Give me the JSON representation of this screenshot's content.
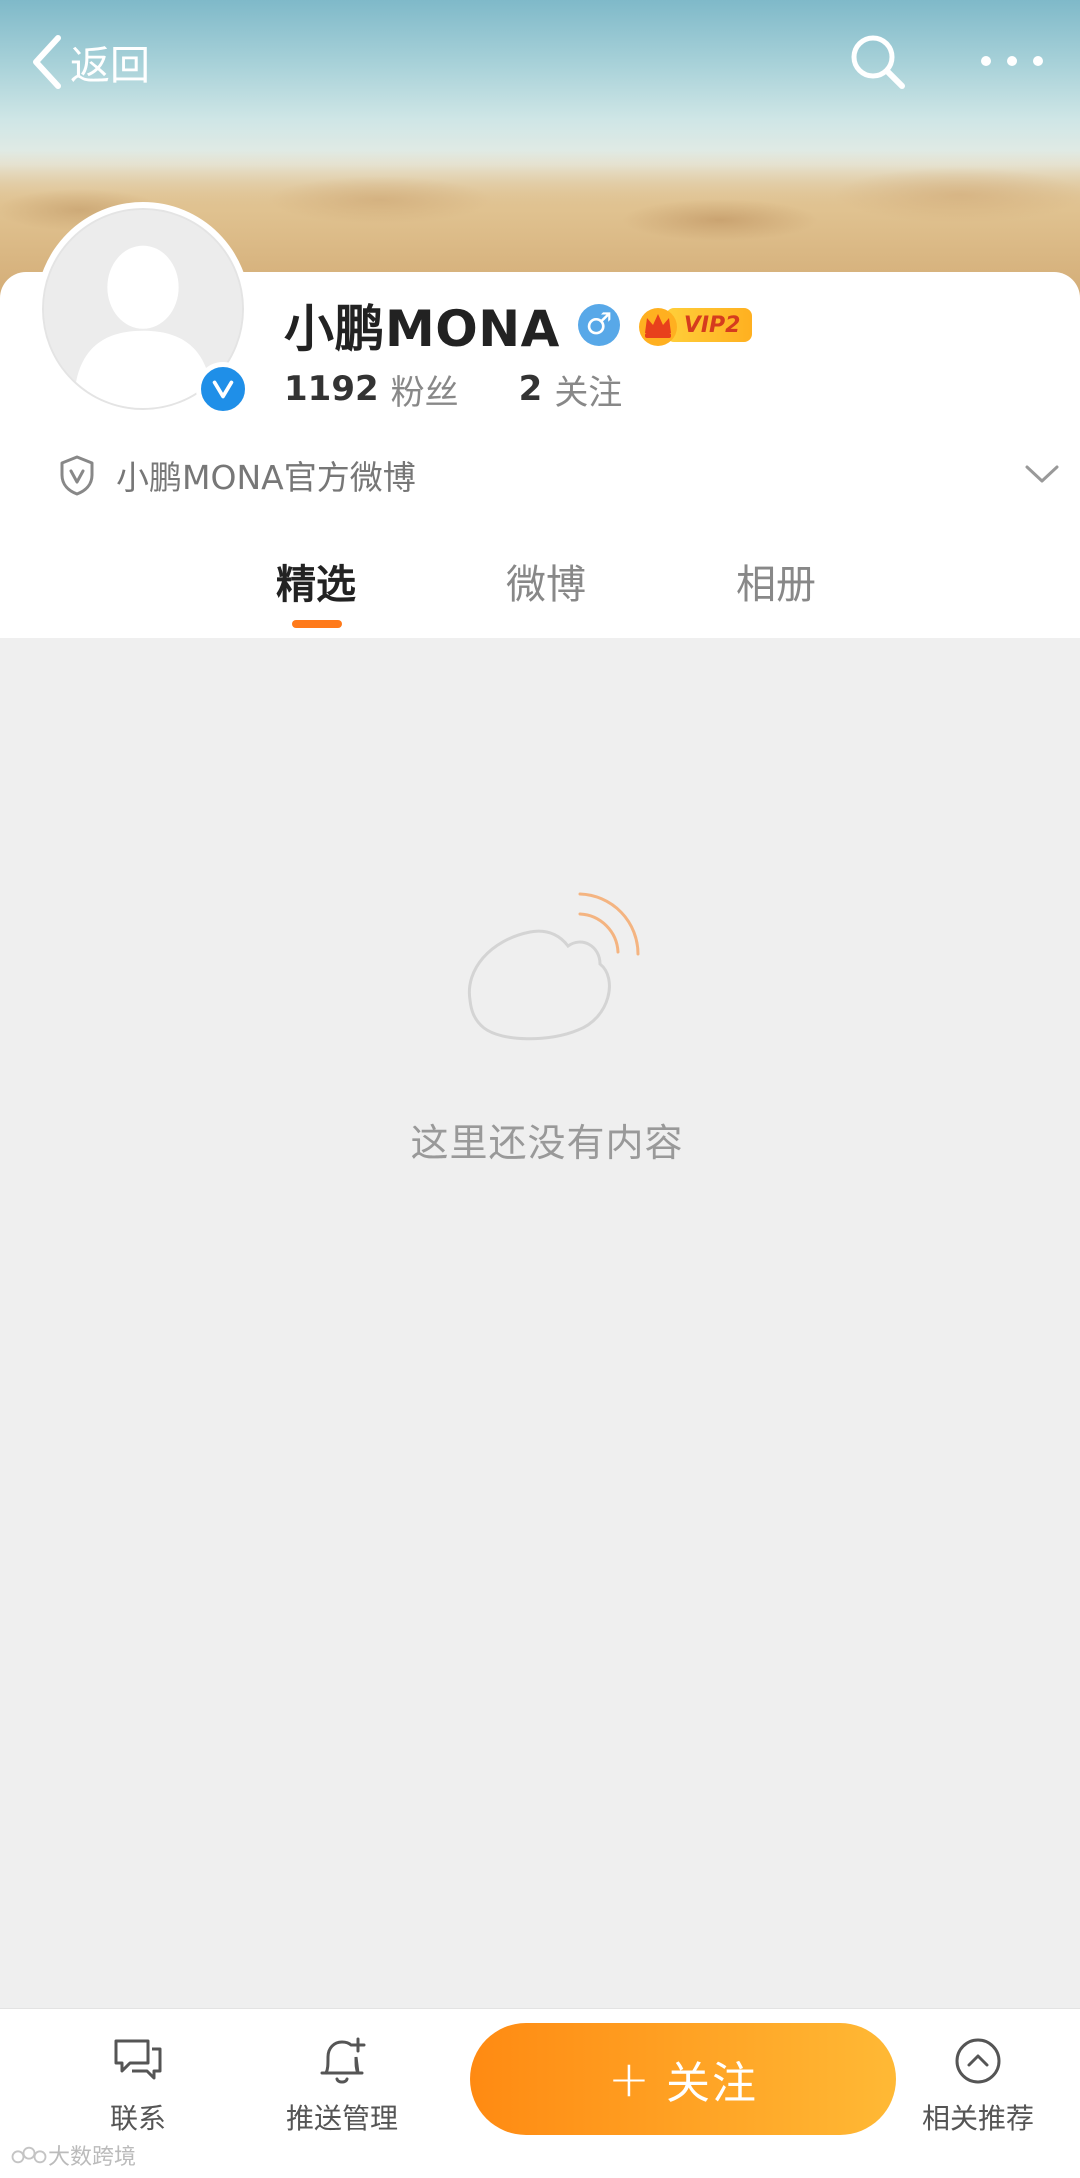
{
  "header": {
    "back_label": "返回",
    "search_icon": "search-icon",
    "more_icon": "more-icon"
  },
  "profile": {
    "name": "小鹏MONA",
    "gender_symbol": "♂",
    "vip_label": "VIP2",
    "fans_count": "1192",
    "fans_label": "粉丝",
    "following_count": "2",
    "following_label": "关注",
    "description": "小鹏MONA官方微博",
    "verified_mark": "V"
  },
  "tabs": [
    {
      "label": "精选",
      "active": true
    },
    {
      "label": "微博",
      "active": false
    },
    {
      "label": "相册",
      "active": false
    }
  ],
  "content": {
    "empty_text": "这里还没有内容"
  },
  "bottom_bar": {
    "contact_label": "联系",
    "push_label": "推送管理",
    "follow_label": "关注",
    "follow_plus": "+",
    "recommend_label": "相关推荐"
  },
  "watermark": {
    "text": "大数跨境"
  },
  "colors": {
    "accent": "#ff7a1a",
    "verified": "#1f8fe8",
    "gender": "#58a8e8"
  }
}
